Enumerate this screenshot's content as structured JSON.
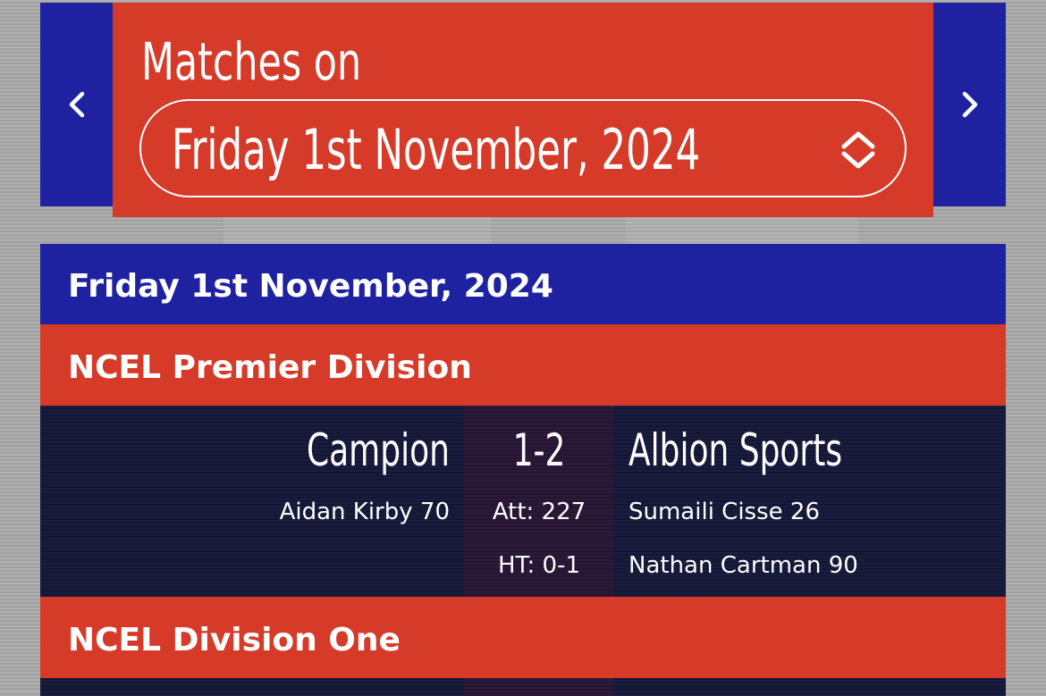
{
  "header": {
    "title": "Matches on",
    "selected_date": "Friday 1st November, 2024",
    "prev_icon": "chevron-left-icon",
    "next_icon": "chevron-right-icon",
    "select_icon": "chevron-up-down-icon"
  },
  "colors": {
    "accent_red": "#d63a28",
    "accent_blue": "#1e22a0",
    "match_background": "#141838"
  },
  "fixtures": {
    "day_label": "Friday 1st November, 2024",
    "divisions": [
      {
        "name": "NCEL Premier Division",
        "matches": [
          {
            "home_team": "Campion",
            "away_team": "Albion Sports",
            "score": "1-2",
            "attendance": "Att: 227",
            "half_time": "HT: 0-1",
            "home_scorers": [
              "Aidan Kirby 70"
            ],
            "away_scorers": [
              "Sumaili Cisse 26",
              "Nathan Cartman 90"
            ]
          }
        ]
      },
      {
        "name": "NCEL Division One",
        "matches": []
      }
    ]
  }
}
